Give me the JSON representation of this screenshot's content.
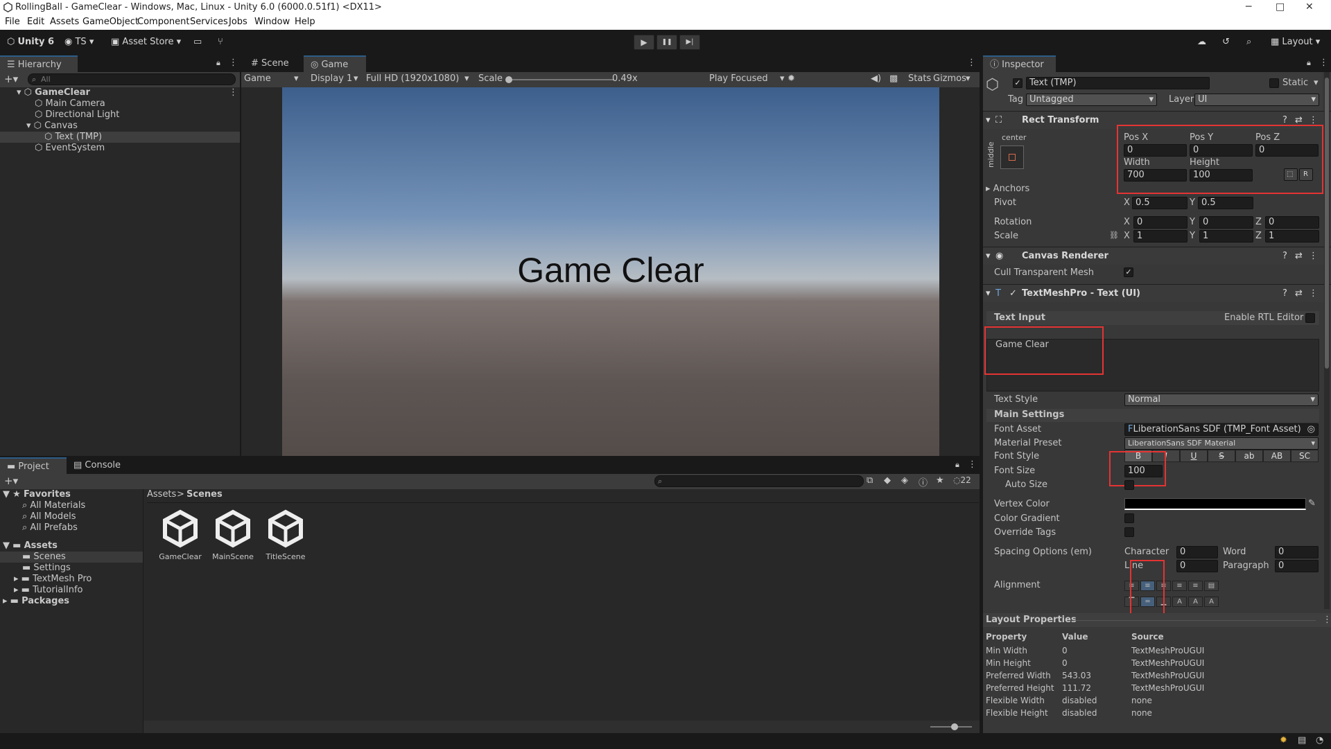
{
  "window": {
    "title": "RollingBall - GameClear - Windows, Mac, Linux - Unity 6.0 (6000.0.51f1) <DX11>",
    "minimize": "─",
    "maximize": "□",
    "close": "✕"
  },
  "menu": [
    "File",
    "Edit",
    "Assets",
    "GameObject",
    "Component",
    "Services",
    "Jobs",
    "Window",
    "Help"
  ],
  "toolbar": {
    "unity": "Unity 6",
    "account": "TS",
    "asset_store": "Asset Store",
    "layout": "Layout",
    "play": "▶",
    "pause": "❚❚",
    "step": "▶|"
  },
  "hierarchy": {
    "tab": "Hierarchy",
    "search_placeholder": "All",
    "items": [
      {
        "label": "GameClear",
        "indent": 0,
        "bold": true
      },
      {
        "label": "Main Camera",
        "indent": 1
      },
      {
        "label": "Directional Light",
        "indent": 1
      },
      {
        "label": "Canvas",
        "indent": 1
      },
      {
        "label": "Text (TMP)",
        "indent": 2,
        "selected": true
      },
      {
        "label": "EventSystem",
        "indent": 1
      }
    ]
  },
  "game_view": {
    "tabs": [
      "Scene",
      "Game"
    ],
    "view": "Game",
    "display": "Display 1",
    "resolution": "Full HD (1920x1080)",
    "scale_label": "Scale",
    "scale_value": "0.49x",
    "play_mode": "Play Focused",
    "stats": "Stats",
    "gizmos": "Gizmos",
    "text": "Game Clear"
  },
  "project": {
    "tabs": [
      "Project",
      "Console"
    ],
    "count": "22",
    "favorites_label": "Favorites",
    "favorites": [
      "All Materials",
      "All Models",
      "All Prefabs"
    ],
    "assets_label": "Assets",
    "asset_folders": [
      "Scenes",
      "Settings",
      "TextMesh Pro",
      "TutorialInfo"
    ],
    "packages_label": "Packages",
    "breadcrumb": [
      "Assets",
      "Scenes"
    ],
    "scenes": [
      "GameClear",
      "MainScene",
      "TitleScene"
    ]
  },
  "inspector": {
    "tab": "Inspector",
    "object_name": "Text (TMP)",
    "static": "Static",
    "tag_label": "Tag",
    "tag": "Untagged",
    "layer_label": "Layer",
    "layer": "UI",
    "rect": {
      "title": "Rect Transform",
      "anchor_h": "center",
      "anchor_v": "middle",
      "posx_label": "Pos X",
      "posy_label": "Pos Y",
      "posz_label": "Pos Z",
      "posx": "0",
      "posy": "0",
      "posz": "0",
      "width_label": "Width",
      "height_label": "Height",
      "width": "700",
      "height": "100",
      "r": "R",
      "anchors": "Anchors",
      "pivot": "Pivot",
      "pivot_x": "0.5",
      "pivot_y": "0.5",
      "rotation": "Rotation",
      "rot_x": "0",
      "rot_y": "0",
      "rot_z": "0",
      "scale": "Scale",
      "scale_x": "1",
      "scale_y": "1",
      "scale_z": "1",
      "x": "X",
      "y": "Y",
      "z": "Z"
    },
    "canvas_renderer": {
      "title": "Canvas Renderer",
      "cull": "Cull Transparent Mesh"
    },
    "tmp": {
      "title": "TextMeshPro - Text (UI)",
      "text_input": "Text Input",
      "rtl": "Enable RTL Editor",
      "text": "Game Clear",
      "text_style_label": "Text Style",
      "text_style": "Normal",
      "main_settings": "Main Settings",
      "font_asset_label": "Font Asset",
      "font_asset": "LiberationSans SDF (TMP_Font Asset)",
      "material_preset_label": "Material Preset",
      "material_preset": "LiberationSans SDF Material",
      "font_style_label": "Font Style",
      "font_styles": [
        "B",
        "I",
        "U",
        "S",
        "ab",
        "AB",
        "SC"
      ],
      "font_size_label": "Font Size",
      "font_size": "100",
      "auto_size": "Auto Size",
      "vertex_color": "Vertex Color",
      "color_gradient": "Color Gradient",
      "override_tags": "Override Tags",
      "spacing": "Spacing Options (em)",
      "character": "Character",
      "character_val": "0",
      "word": "Word",
      "word_val": "0",
      "line": "Line",
      "line_val": "0",
      "paragraph": "Paragraph",
      "paragraph_val": "0",
      "alignment": "Alignment"
    },
    "layout_props": {
      "title": "Layout Properties",
      "headers": [
        "Property",
        "Value",
        "Source"
      ],
      "rows": [
        [
          "Min Width",
          "0",
          "TextMeshProUGUI"
        ],
        [
          "Min Height",
          "0",
          "TextMeshProUGUI"
        ],
        [
          "Preferred Width",
          "543.03",
          "TextMeshProUGUI"
        ],
        [
          "Preferred Height",
          "111.72",
          "TextMeshProUGUI"
        ],
        [
          "Flexible Width",
          "disabled",
          "none"
        ],
        [
          "Flexible Height",
          "disabled",
          "none"
        ]
      ]
    }
  }
}
